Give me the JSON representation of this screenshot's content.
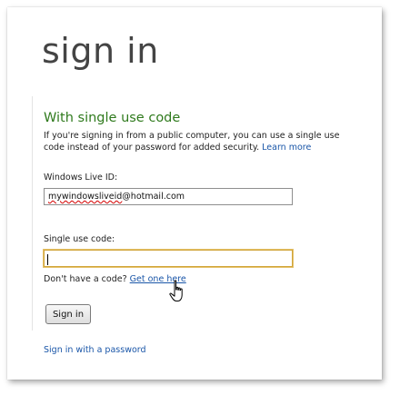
{
  "page": {
    "title": "sign in"
  },
  "section": {
    "heading": "With single use code",
    "intro_text": "If you're signing in from a public computer, you can use a single use code instead of your password for added security.",
    "learn_more_label": "Learn more"
  },
  "form": {
    "live_id_label": "Windows Live ID:",
    "live_id_value_user": "mywindowsliveid",
    "live_id_value_domain": "@hotmail.com",
    "code_label": "Single use code:",
    "code_value": ""
  },
  "help": {
    "no_code_text": "Don't have a code?",
    "get_one_label": "Get one here"
  },
  "actions": {
    "sign_in_label": "Sign in",
    "password_link_label": "Sign in with a password"
  },
  "colors": {
    "heading_green": "#2f7a1d",
    "link_blue": "#1a56a8",
    "focus_border": "#d1a53a"
  },
  "cursor": {
    "icon": "hand-pointer-icon"
  }
}
